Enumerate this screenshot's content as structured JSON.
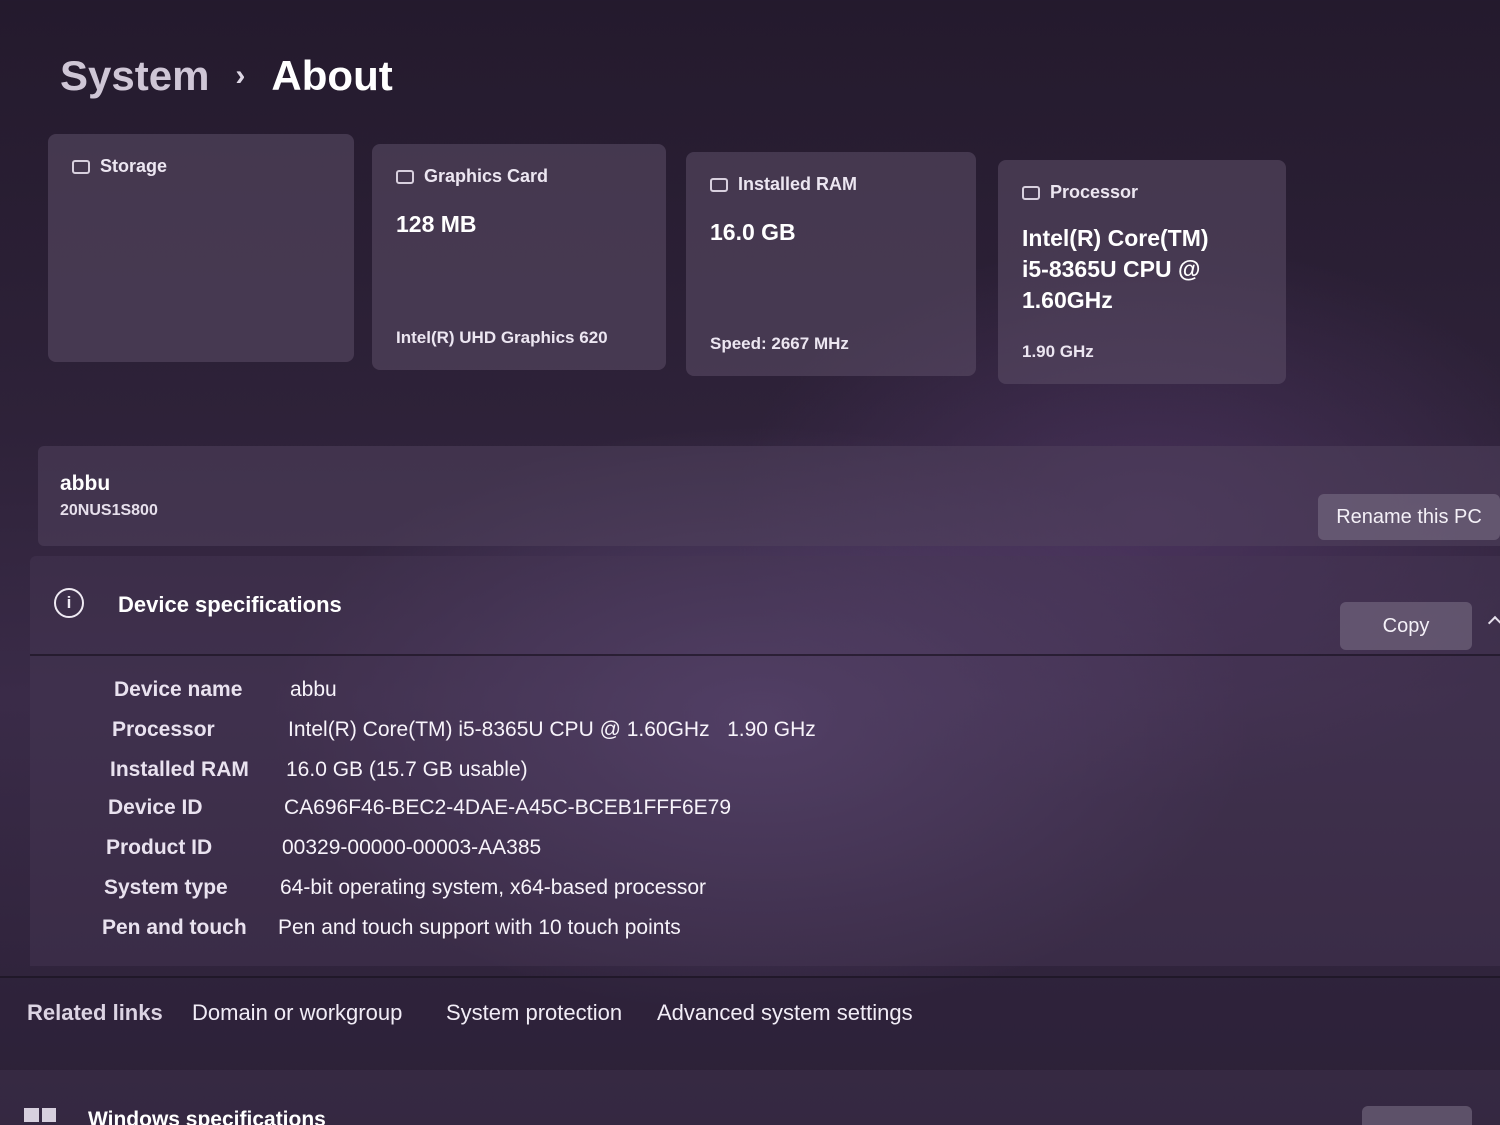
{
  "breadcrumb": {
    "parent": "System",
    "separator": "›",
    "current": "About"
  },
  "cards": {
    "storage": {
      "title": "Storage",
      "icon": "storage-icon"
    },
    "graphics": {
      "title": "Graphics Card",
      "value": "128 MB",
      "detail": "Intel(R) UHD Graphics 620",
      "icon": "graphics-card-icon"
    },
    "ram": {
      "title": "Installed RAM",
      "value": "16.0 GB",
      "detail": "Speed: 2667 MHz",
      "icon": "ram-icon"
    },
    "processor": {
      "title": "Processor",
      "value_line1": "Intel(R) Core(TM)",
      "value_line2": "i5-8365U CPU @",
      "value_line3": "1.60GHz",
      "detail": "1.90 GHz",
      "icon": "processor-icon"
    }
  },
  "pc": {
    "name": "abbu",
    "model": "20NUS1S800",
    "rename_label": "Rename this PC"
  },
  "device_specs": {
    "title": "Device specifications",
    "copy_label": "Copy",
    "rows": [
      {
        "label": "Device name",
        "value": "abbu"
      },
      {
        "label": "Processor",
        "value": "Intel(R) Core(TM) i5-8365U CPU @ 1.60GHz   1.90 GHz"
      },
      {
        "label": "Installed RAM",
        "value": "16.0 GB (15.7 GB usable)"
      },
      {
        "label": "Device ID",
        "value": "CA696F46-BEC2-4DAE-A45C-BCEB1FFF6E79"
      },
      {
        "label": "Product ID",
        "value": "00329-00000-00003-AA385"
      },
      {
        "label": "System type",
        "value": "64-bit operating system, x64-based processor"
      },
      {
        "label": "Pen and touch",
        "value": "Pen and touch support with 10 touch points"
      }
    ]
  },
  "related": {
    "title": "Related links",
    "links": [
      "Domain or workgroup",
      "System protection",
      "Advanced system settings"
    ]
  },
  "windows_specs": {
    "title": "Windows specifications"
  }
}
